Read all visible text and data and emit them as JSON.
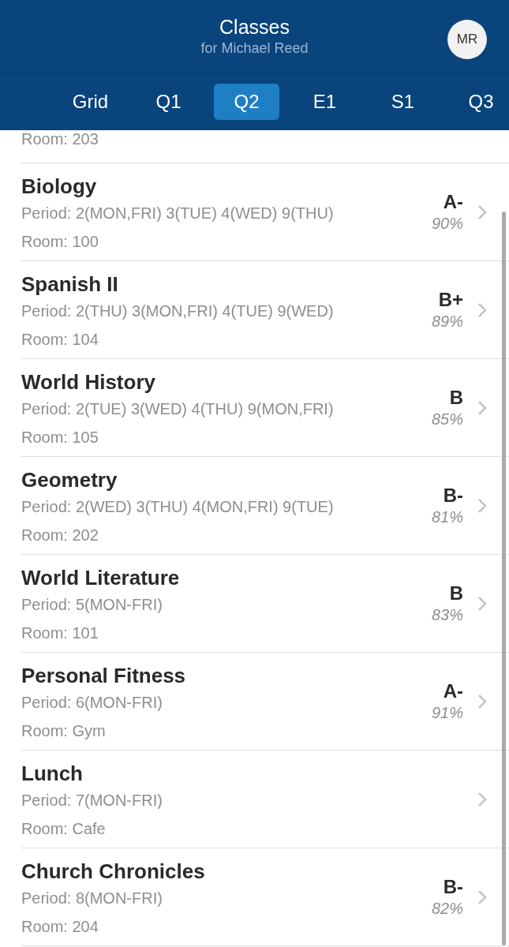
{
  "header": {
    "title": "Classes",
    "subtitle": "for Michael Reed",
    "avatar": "MR"
  },
  "tabs": [
    {
      "label": "Grid",
      "selected": false
    },
    {
      "label": "Q1",
      "selected": false
    },
    {
      "label": "Q2",
      "selected": true
    },
    {
      "label": "E1",
      "selected": false
    },
    {
      "label": "S1",
      "selected": false
    },
    {
      "label": "Q3",
      "selected": false
    }
  ],
  "partial_row": {
    "room": "Room: 203"
  },
  "classes": [
    {
      "name": "Biology",
      "period": "Period: 2(MON,FRI) 3(TUE) 4(WED) 9(THU)",
      "room": "Room: 100",
      "grade": "A-",
      "percent": "90%"
    },
    {
      "name": "Spanish II",
      "period": "Period: 2(THU) 3(MON,FRI) 4(TUE) 9(WED)",
      "room": "Room: 104",
      "grade": "B+",
      "percent": "89%"
    },
    {
      "name": "World History",
      "period": "Period: 2(TUE) 3(WED) 4(THU) 9(MON,FRI)",
      "room": "Room: 105",
      "grade": "B",
      "percent": "85%"
    },
    {
      "name": "Geometry",
      "period": "Period: 2(WED) 3(THU) 4(MON,FRI) 9(TUE)",
      "room": "Room: 202",
      "grade": "B-",
      "percent": "81%"
    },
    {
      "name": "World Literature",
      "period": "Period: 5(MON-FRI)",
      "room": "Room: 101",
      "grade": "B",
      "percent": "83%"
    },
    {
      "name": "Personal Fitness",
      "period": "Period: 6(MON-FRI)",
      "room": "Room: Gym",
      "grade": "A-",
      "percent": "91%"
    },
    {
      "name": "Lunch",
      "period": "Period: 7(MON-FRI)",
      "room": "Room: Cafe"
    },
    {
      "name": "Church Chronicles",
      "period": "Period: 8(MON-FRI)",
      "room": "Room: 204",
      "grade": "B-",
      "percent": "82%"
    }
  ]
}
